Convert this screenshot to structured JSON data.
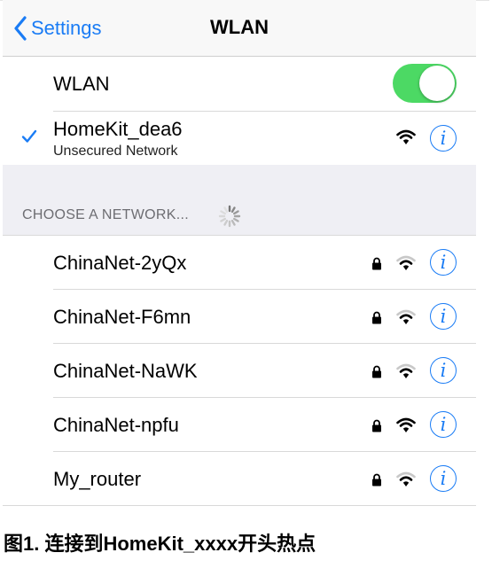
{
  "navbar": {
    "back_label": "Settings",
    "title": "WLAN"
  },
  "wlan": {
    "label": "WLAN",
    "enabled": true,
    "toggle_color": "#4cd964"
  },
  "connected": {
    "name": "HomeKit_dea6",
    "status": "Unsecured Network",
    "signal": "full",
    "secured": false
  },
  "section": {
    "title": "CHOOSE A NETWORK..."
  },
  "networks": [
    {
      "name": "ChinaNet-2yQx",
      "secured": true,
      "signal": "weak"
    },
    {
      "name": "ChinaNet-F6mn",
      "secured": true,
      "signal": "weak"
    },
    {
      "name": "ChinaNet-NaWK",
      "secured": true,
      "signal": "weak"
    },
    {
      "name": "ChinaNet-npfu",
      "secured": true,
      "signal": "full"
    },
    {
      "name": "My_router",
      "secured": true,
      "signal": "medium"
    }
  ],
  "caption": "图1. 连接到HomeKit_xxxx开头热点",
  "colors": {
    "accent": "#1a7cf5",
    "section_bg": "#efeff4",
    "navbar_bg": "#f8f8f8"
  },
  "icons": {
    "back": "chevron-left-icon",
    "check": "checkmark-icon",
    "info": "info-icon",
    "wifi": "wifi-icon",
    "lock": "lock-icon",
    "spinner": "spinner-icon"
  }
}
